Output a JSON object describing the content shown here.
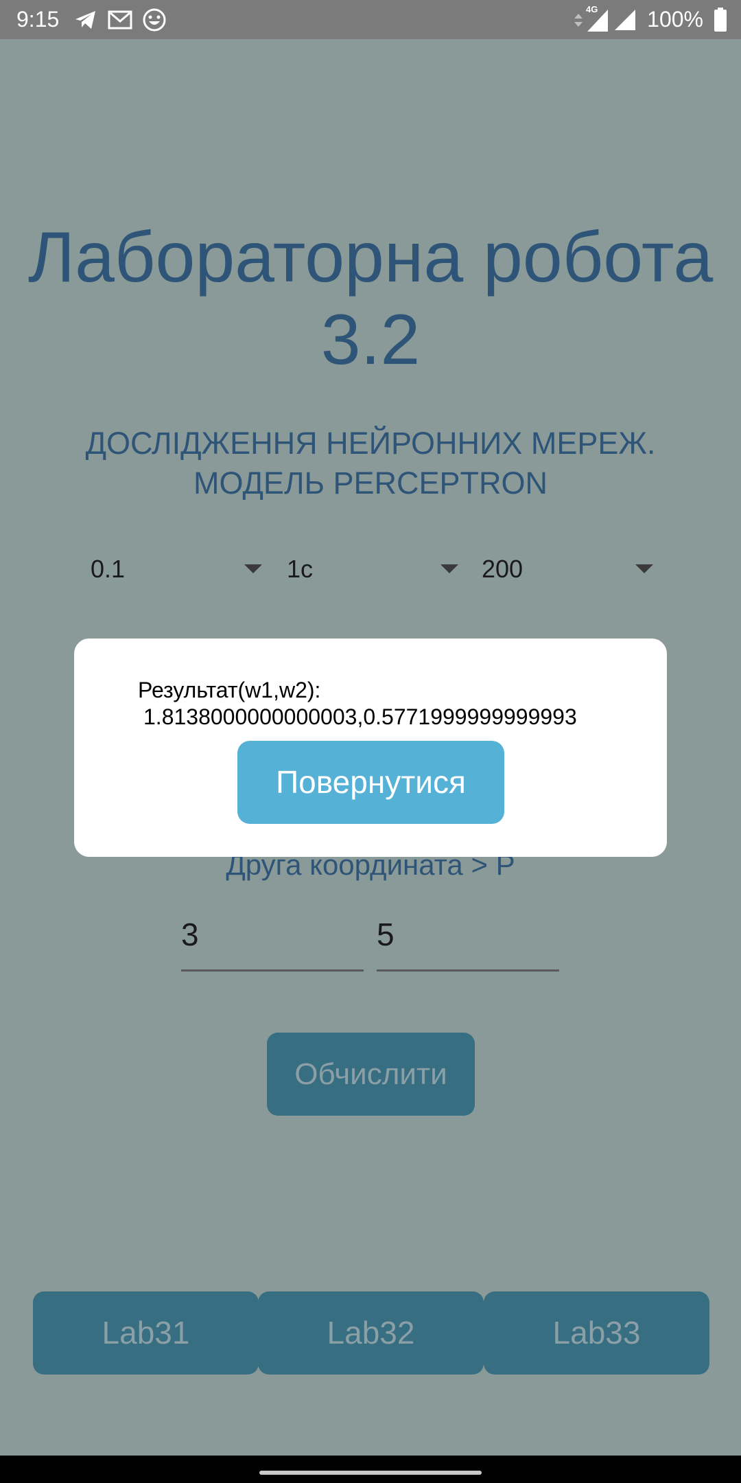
{
  "status_bar": {
    "time": "9:15",
    "left_icons": [
      "telegram-icon",
      "gmail-icon",
      "emoji-app-icon"
    ],
    "right_icons": [
      "data-arrows-icon",
      "signal-4g-icon",
      "signal-icon",
      "battery-icon"
    ],
    "network_label": "4G",
    "battery": "100%"
  },
  "header": {
    "title_line1": "Лабораторна робота",
    "title_line2": "3.2",
    "subtitle_line1": "ДОСЛІДЖЕННЯ НЕЙРОННИХ МЕРЕЖ.",
    "subtitle_line2": "МОДЕЛЬ PERCEPTRON"
  },
  "dropdowns": [
    {
      "value": "0.1"
    },
    {
      "value": "1с"
    },
    {
      "value": "200"
    }
  ],
  "coordinate": {
    "label": "Друга координата > P",
    "fields": [
      {
        "value": "3"
      },
      {
        "value": "5"
      }
    ]
  },
  "calculate_button": "Обчислити",
  "lab_tabs": [
    "Lab31",
    "Lab32",
    "Lab33"
  ],
  "dialog": {
    "result_label": "Результат(w1,w2):",
    "result_value": "1.8138000000000003,0.5771999999999993",
    "return_button": "Повернутися"
  },
  "colors": {
    "background": "#8a9a98",
    "title": "#2e5478",
    "button_dark": "#376e82",
    "button_accent": "#55b2d6",
    "dialog": "#ffffff"
  }
}
